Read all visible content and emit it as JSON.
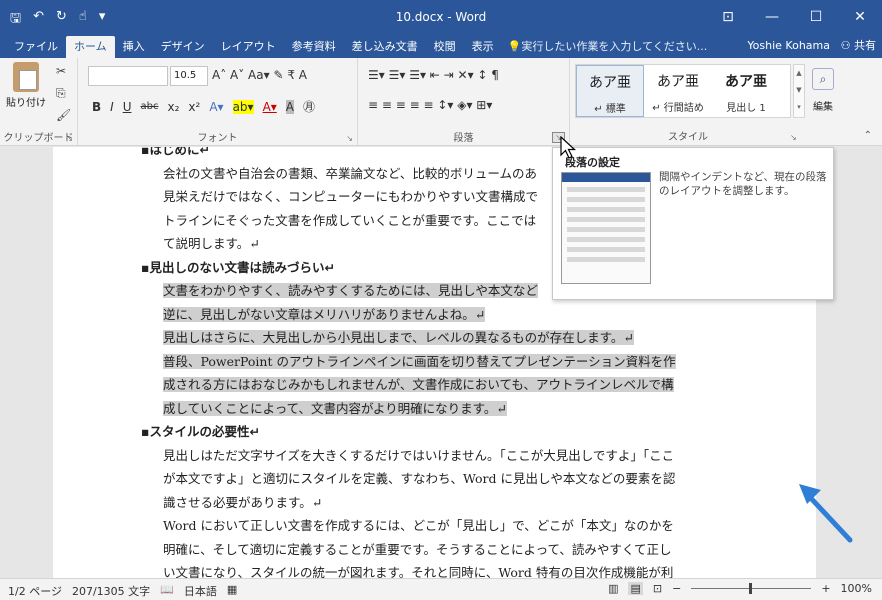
{
  "window": {
    "title": "10.docx - Word",
    "qat_icons": [
      "save-icon",
      "undo-icon",
      "redo-icon",
      "touch-mode-icon",
      "customize-icon"
    ],
    "controls": {
      "ribbon_options": "⊡",
      "minimize": "—",
      "maximize": "☐",
      "close": "✕"
    }
  },
  "tabs": [
    "ファイル",
    "ホーム",
    "挿入",
    "デザイン",
    "レイアウト",
    "参考資料",
    "差し込み文書",
    "校閲",
    "表示"
  ],
  "active_tab": "ホーム",
  "tell_me": "実行したい作業を入力してください...",
  "user": "Yoshie Kohama",
  "share": "共有",
  "ribbon": {
    "clipboard": {
      "label": "クリップボード",
      "paste": "貼り付け"
    },
    "font": {
      "label": "フォント",
      "font_name": "",
      "font_size": "10.5",
      "row1": "A˄ A˅ Aa▾ ✎ ₹ A",
      "row2": [
        "B",
        "I",
        "U",
        "abc",
        "x₂",
        "x²",
        "A▾",
        "ab▾",
        "A▾",
        "A",
        "㊊"
      ]
    },
    "paragraph": {
      "label": "段落",
      "row1": "☰▾ ☰▾ ☰▾ ⇤ ⇥ ✕▾ ↕ ¶",
      "row2": "≡ ≡ ≡ ≡ ≡ ↕▾ ◈▾ ⊞▾"
    },
    "styles": {
      "label": "スタイル",
      "items": [
        {
          "sample": "あア亜",
          "name": "↵ 標準"
        },
        {
          "sample": "あア亜",
          "name": "↵ 行間詰め"
        },
        {
          "sample": "あア亜",
          "name": "見出し 1"
        }
      ]
    },
    "editing": {
      "label": "編集"
    }
  },
  "document": {
    "lines": [
      {
        "text": "▪はじめに↵",
        "type": "h"
      },
      {
        "text": "会社の文書や自治会の書類、卒業論文など、比較的ボリュームのあ",
        "type": "p"
      },
      {
        "text": "見栄えだけではなく、コンピューターにもわかりやすい文書構成で",
        "type": "p"
      },
      {
        "text": "トラインにそぐった文書を作成していくことが重要です。ここでは",
        "type": "p"
      },
      {
        "text": "て説明します。↵",
        "type": "p"
      },
      {
        "text": "▪見出しのない文書は読みづらい↵",
        "type": "h"
      },
      {
        "text": "文書をわかりやすく、読みやすくするためには、見出しや本文など",
        "type": "hl"
      },
      {
        "text": "逆に、見出しがない文章はメリハリがありませんよね。↵",
        "type": "hl"
      },
      {
        "text": "見出しはさらに、大見出しから小見出しまで、レベルの異なるものが存在します。↵",
        "type": "hl"
      },
      {
        "text": "普段、PowerPoint のアウトラインペインに画面を切り替えてプレゼンテーション資料を作",
        "type": "hl"
      },
      {
        "text": "成される方にはおなじみかもしれませんが、文書作成においても、アウトラインレベルで構",
        "type": "hl"
      },
      {
        "text": "成していくことによって、文書内容がより明確になります。↵",
        "type": "hl"
      },
      {
        "text": "▪スタイルの必要性↵",
        "type": "h"
      },
      {
        "text": "見出しはただ文字サイズを大きくするだけではいけません。「ここが大見出しですよ」「ここ",
        "type": "p"
      },
      {
        "text": "が本文ですよ」と適切にスタイルを定義、すなわち、Word に見出しや本文などの要素を認",
        "type": "p"
      },
      {
        "text": "識させる必要があります。↵",
        "type": "p"
      },
      {
        "text": "Word において正しい文書を作成するには、どこが「見出し」で、どこが「本文」なのかを",
        "type": "p"
      },
      {
        "text": "明確に、そして適切に定義することが重要です。そうすることによって、読みやすくて正し",
        "type": "p"
      },
      {
        "text": "い文書になり、スタイルの統一が図れます。それと同時に、Word 特有の目次作成機能が利",
        "type": "p"
      }
    ]
  },
  "tooltip": {
    "title": "段落の設定",
    "description": "間隔やインデントなど、現在の段落のレイアウトを調整します。"
  },
  "status": {
    "page": "1/2 ページ",
    "words": "207/1305 文字",
    "language": "日本語",
    "zoom": "100%",
    "zoom_minus": "−",
    "zoom_plus": "+"
  },
  "colors": {
    "accent": "#2b579a",
    "highlight": "#cfcfcf",
    "arrow": "#2f7fd6"
  }
}
